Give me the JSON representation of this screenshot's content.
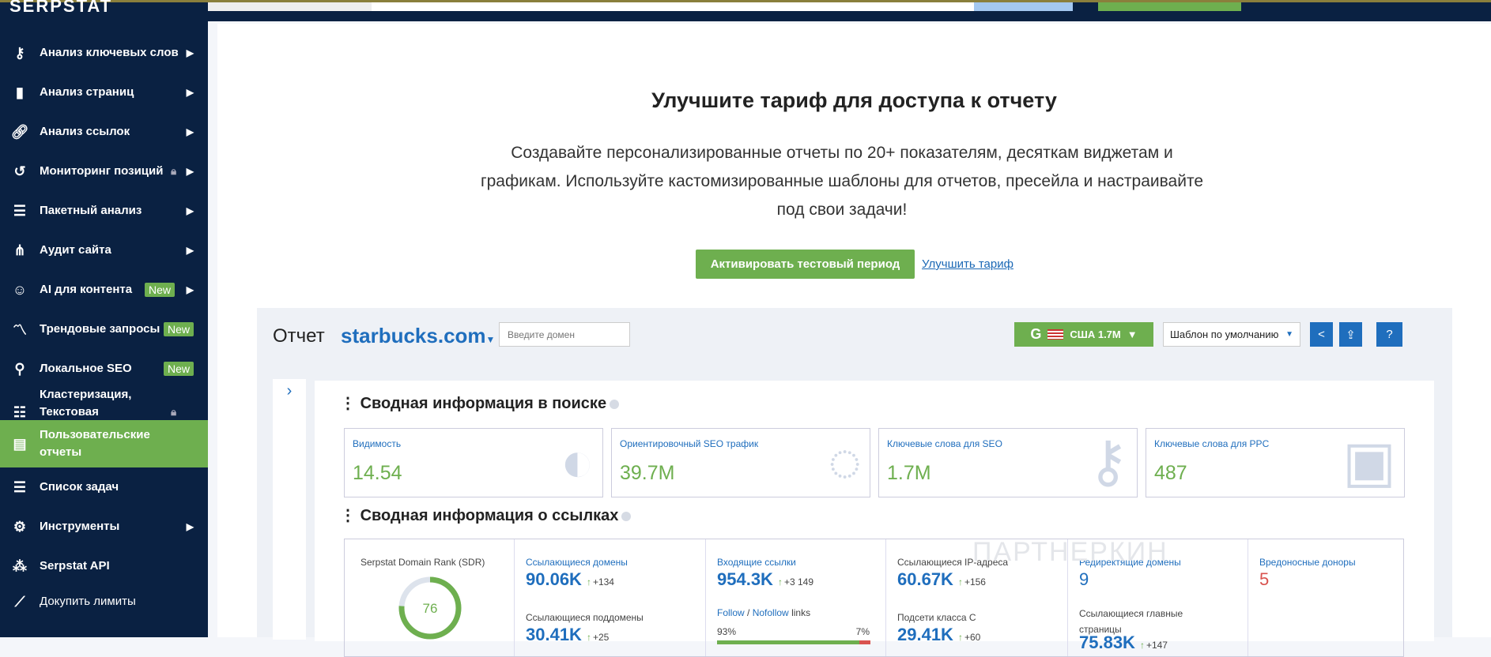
{
  "brand": "SERPSTAT",
  "sidebar": {
    "items": [
      {
        "label": "Анализ ключевых слов",
        "icon": "key-icon"
      },
      {
        "label": "Анализ страниц",
        "icon": "bar-chart-icon"
      },
      {
        "label": "Анализ ссылок",
        "icon": "link-icon"
      },
      {
        "label": "Мониторинг позиций",
        "icon": "history-icon"
      },
      {
        "label": "Пакетный анализ",
        "icon": "database-icon"
      },
      {
        "label": "Аудит сайта",
        "icon": "sitemap-icon"
      },
      {
        "label": "AI для контента",
        "icon": "robot-icon",
        "badge": "New"
      },
      {
        "label": "Трендовые запросы",
        "icon": "trend-icon",
        "badge": "New"
      },
      {
        "label": "Локальное SEO",
        "icon": "map-pin-icon",
        "badge": "New"
      },
      {
        "label": "Кластеризация, Текстовая аналитика",
        "icon": "cluster-icon"
      },
      {
        "label": "Пользовательские отчеты",
        "icon": "report-icon"
      },
      {
        "label": "Список задач",
        "icon": "list-icon"
      },
      {
        "label": "Инструменты",
        "icon": "gear-icon"
      },
      {
        "label": "Serpstat API",
        "icon": "api-icon"
      },
      {
        "label": "Докупить лимиты",
        "icon": "limits-icon"
      }
    ]
  },
  "upgrade": {
    "title": "Улучшите тариф для доступа к отчету",
    "description": "Создавайте персонализированные отчеты по 20+ показателям, десяткам виджетам и графикам. Используйте кастомизированные шаблоны для отчетов, пресейла и настраивайте под свои задачи!",
    "activate_button": "Активировать тестовый период",
    "upgrade_link": "Улучшить тариф"
  },
  "report": {
    "title": "Отчет",
    "domain": "starbucks.com",
    "domain_placeholder": "Введите домен",
    "search_engine": "G",
    "region": "США 1.7M",
    "template": "Шаблон по умолчанию",
    "search_section": "Сводная информация в поиске",
    "cards": [
      {
        "title": "Видимость",
        "value": "14.54"
      },
      {
        "title": "Ориентировочный SEO трафик",
        "value": "39.7M"
      },
      {
        "title": "Ключевые слова для SEO",
        "value": "1.7M"
      },
      {
        "title": "Ключевые слова для PPC",
        "value": "487"
      }
    ],
    "links_section": "Сводная информация о ссылках",
    "sdr_label": "Serpstat Domain Rank (SDR)",
    "sdr_value": "76",
    "sdr_percent": 76,
    "ref_domains": {
      "label": "Ссылающиеся домены",
      "value": "90.06K",
      "delta": "+134"
    },
    "ref_subdomains": {
      "label": "Ссылающиеся поддомены",
      "value": "30.41K",
      "delta": "+25"
    },
    "backlinks": {
      "label": "Входящие ссылки",
      "value": "954.3K",
      "delta": "+3 149"
    },
    "follow": {
      "follow": "Follow",
      "sep": " / ",
      "nofollow": "Nofollow",
      "links": " links",
      "follow_pct": "93%",
      "nofollow_pct": "7%",
      "follow_value": 93
    },
    "ref_ips": {
      "label": "Ссылающиеся IP-адреса",
      "value": "60.67K",
      "delta": "+156"
    },
    "subnets": {
      "label": "Подсети класса C",
      "value": "29.41K",
      "delta": "+60"
    },
    "redirects": {
      "label": "Редиректящие домены",
      "value": "9"
    },
    "main_pages": {
      "label": "Ссылающиеся главные страницы",
      "value": "75.83K",
      "delta": "+147"
    },
    "malicious": {
      "label": "Вредоносные доноры",
      "value": "5"
    }
  },
  "watermark": "ПАРТНЕРКИН",
  "colors": {
    "navy": "#0a2142",
    "green": "#6eaf4f",
    "blue": "#1f6ebd",
    "red": "#d9534f"
  }
}
